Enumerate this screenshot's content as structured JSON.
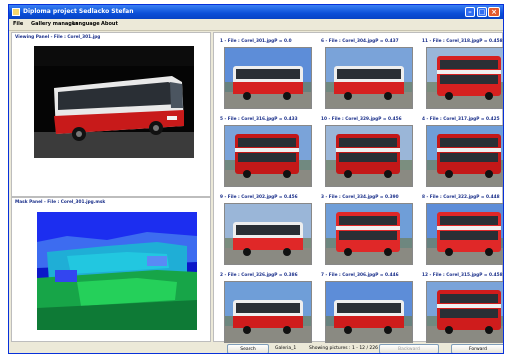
{
  "window": {
    "title": "Diploma project Sedlacko Stefan"
  },
  "menu": {
    "items": [
      "File",
      "Gallery manager",
      "Language",
      "About"
    ]
  },
  "viewing_panel": {
    "label": "Viewing Panel - File : Corel_301.jpg"
  },
  "mask_panel": {
    "label": "Mask Panel - File : Corel_301.jpg.msk"
  },
  "gallery": {
    "items": [
      {
        "label": "1 - File : Corel_301.jpgP = 0.0"
      },
      {
        "label": "5 - File : Corel_316.jpgP = 0.433"
      },
      {
        "label": "9 - File : Corel_302.jpgP = 0.456"
      },
      {
        "label": "2 - File : Corel_326.jpgP = 0.386"
      },
      {
        "label": "6 - File : Corel_304.jpgP = 0.437"
      },
      {
        "label": "10 - File : Corel_329.jpgP = 0.456"
      },
      {
        "label": "3 - File : Corel_334.jpgP = 0.390"
      },
      {
        "label": "7 - File : Corel_306.jpgP = 0.446"
      },
      {
        "label": "11 - File : Corel_318.jpgP = 0.458"
      },
      {
        "label": "4 - File : Corel_317.jpgP = 0.425"
      },
      {
        "label": "8 - File : Corel_322.jpgP = 0.448"
      },
      {
        "label": "12 - File : Corel_315.jpgP = 0.458"
      }
    ]
  },
  "bottom": {
    "search_label": "Search",
    "gallery_name": "Galeria_1",
    "showing": "Showing pictures : 1 - 12 / 226",
    "backward_label": "Backward",
    "forward_label": "Forward"
  },
  "colors": {
    "titlebar": "#0a4fd8",
    "label_text": "#1a2f8a",
    "bus_red": "#d01818"
  }
}
